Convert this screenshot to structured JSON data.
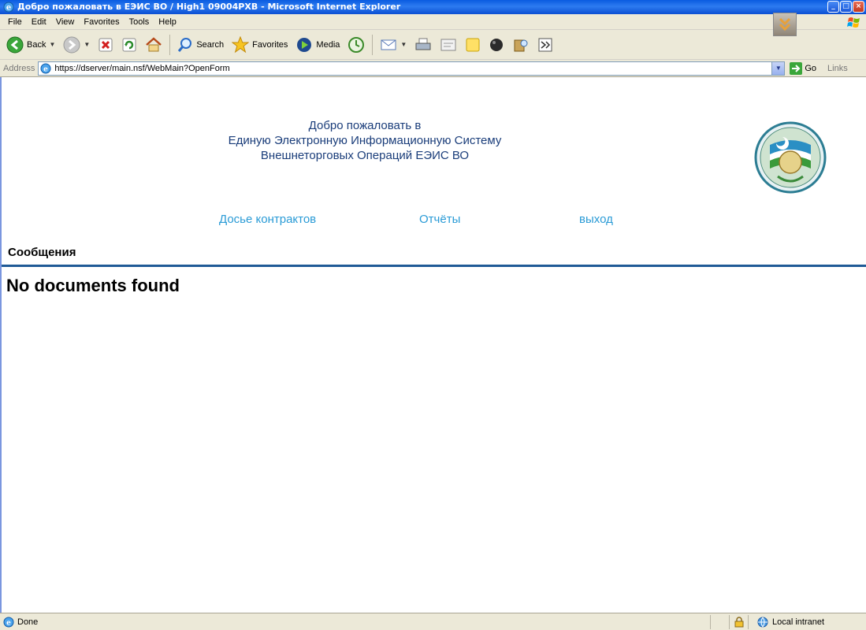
{
  "window": {
    "title": "Добро пожаловать в ЕЭИС ВО / High1 09004PXB - Microsoft Internet Explorer"
  },
  "menu": {
    "items": [
      {
        "label": "File"
      },
      {
        "label": "Edit"
      },
      {
        "label": "View"
      },
      {
        "label": "Favorites"
      },
      {
        "label": "Tools"
      },
      {
        "label": "Help"
      }
    ]
  },
  "toolbar": {
    "back_label": "Back",
    "search_label": "Search",
    "favorites_label": "Favorites",
    "media_label": "Media"
  },
  "address": {
    "label": "Address",
    "url": "https://dserver/main.nsf/WebMain?OpenForm",
    "go_label": "Go",
    "links_label": "Links"
  },
  "page": {
    "welcome_line1": "Добро пожаловать в",
    "welcome_line2": "Единую Электронную Информационную Систему",
    "welcome_line3": "Внешнеторговых Операций ЕЭИС ВО",
    "nav": {
      "contracts": "Досье контрактов",
      "reports": "Отчёты",
      "logout": "выход"
    },
    "section_title": "Сообщения",
    "empty_message": "No documents found"
  },
  "status": {
    "text": "Done",
    "zone": "Local intranet"
  },
  "colors": {
    "nav_link": "#2a9bd6",
    "divider": "#1f5a96",
    "titlebar": "#0a5be0"
  }
}
